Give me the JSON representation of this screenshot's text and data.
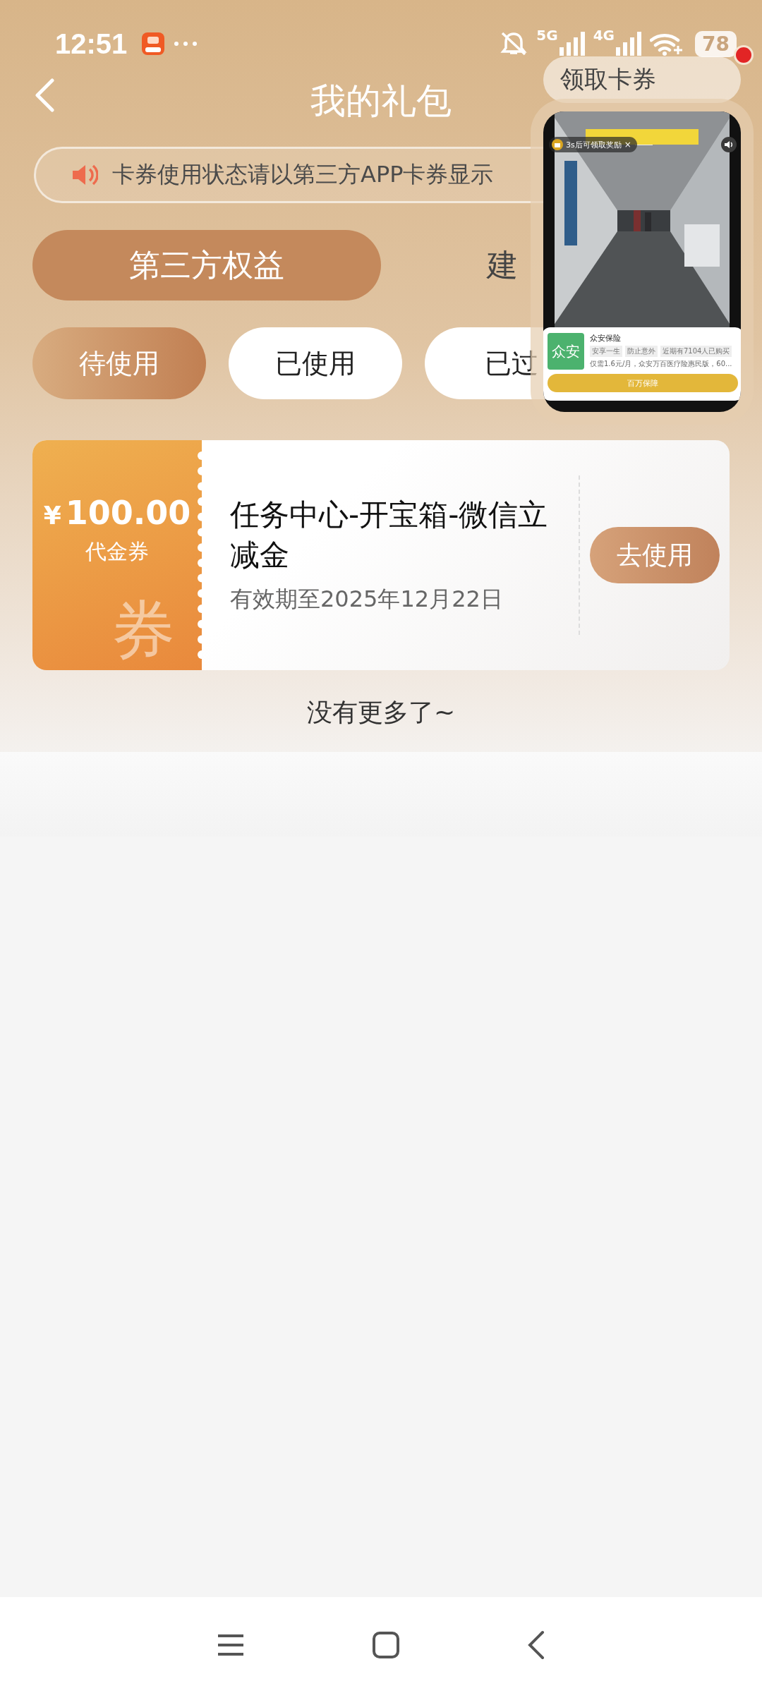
{
  "status_bar": {
    "time": "12:51",
    "network_1": "5G",
    "network_2": "4G",
    "battery": "78"
  },
  "header": {
    "title": "我的礼包",
    "action": "领取卡券",
    "has_notification": true
  },
  "notice": {
    "text": "卡券使用状态请以第三方APP卡券显示"
  },
  "category_tabs": [
    {
      "label": "第三方权益",
      "selected": true
    },
    {
      "label": "建",
      "selected": false
    }
  ],
  "status_tabs": [
    {
      "label": "待使用",
      "selected": true
    },
    {
      "label": "已使用",
      "selected": false
    },
    {
      "label": "已过",
      "selected": false
    }
  ],
  "coupons": [
    {
      "currency": "¥",
      "amount": "100.00",
      "type": "代金券",
      "watermark": "券",
      "title": "任务中心-开宝箱-微信立减金",
      "expiry": "有效期至2025年12月22日",
      "action": "去使用"
    }
  ],
  "end_text": "没有更多了~",
  "floating_ad": {
    "reward": "3s后可领取奖励",
    "close": "×",
    "brand": "众安保险",
    "logo_text": "众安",
    "tags": [
      "安享一生",
      "防止意外",
      "近期有7104人已购买"
    ],
    "description": "仅需1.6元/月，众安万百医疗险惠民版，60...",
    "button": "百万保障"
  }
}
